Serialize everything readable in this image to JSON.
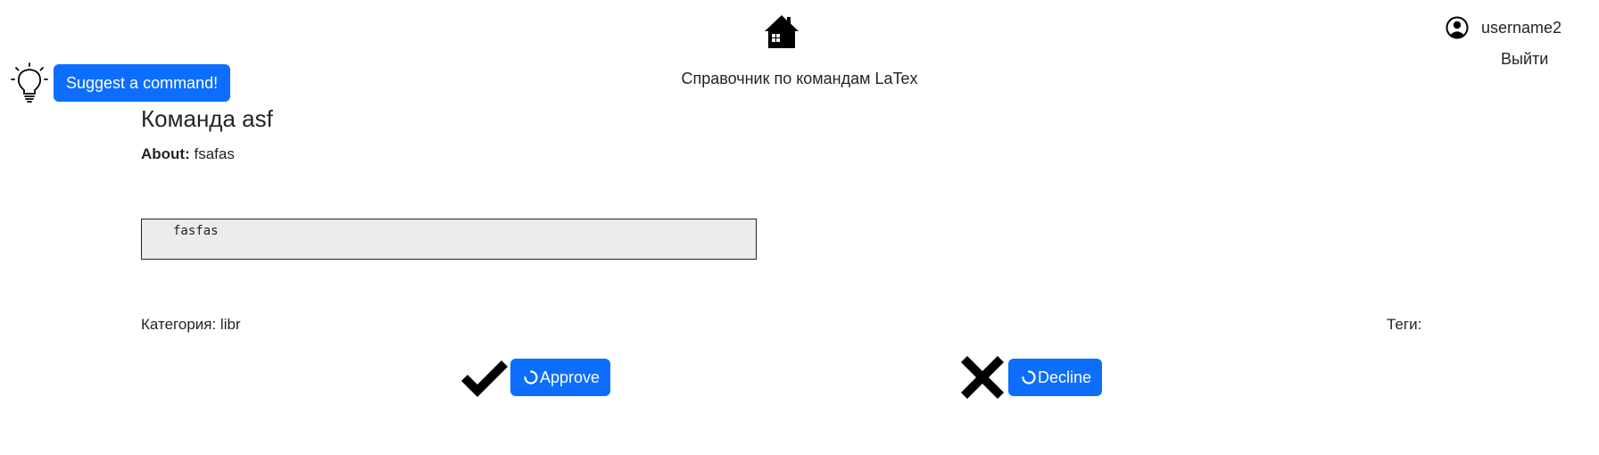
{
  "header": {
    "home_icon": "house-icon",
    "site_title": "Справочник по командам LaTex",
    "user": {
      "icon": "user-circle-icon",
      "username": "username2",
      "logout_label": "Выйти"
    }
  },
  "suggest": {
    "icon": "lightbulb-icon",
    "button_label": "Suggest a command!"
  },
  "command": {
    "title": "Команда asf",
    "about_label": "About:",
    "about_text": "fsafas",
    "code": "fasfas",
    "category_text": "Категория: libr",
    "tags_label": "Теги:"
  },
  "actions": {
    "approve_icon": "checkmark-icon",
    "approve_label": "Approve",
    "decline_icon": "cross-icon",
    "decline_label": "Decline",
    "spinner_icon": "refresh-spinner-icon"
  },
  "colors": {
    "primary": "#0d6efd",
    "text": "#212529",
    "code_bg": "#ececec"
  }
}
